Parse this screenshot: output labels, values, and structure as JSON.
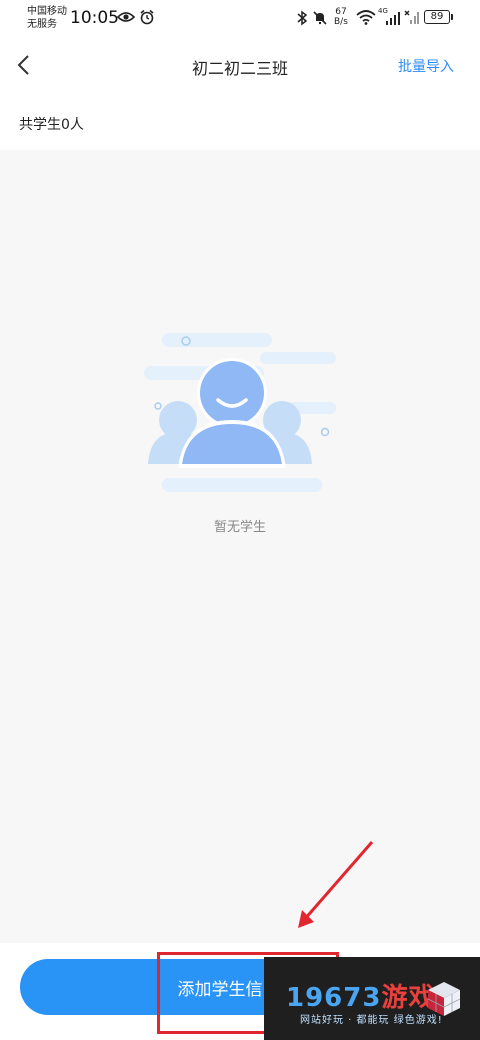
{
  "status_bar": {
    "carrier_line1": "中国移动",
    "carrier_line2": "无服务",
    "time": "10:05",
    "speed_value": "67",
    "speed_unit": "B/s",
    "network": "4G",
    "battery": "89"
  },
  "header": {
    "title": "初二初二三班",
    "import_label": "批量导入"
  },
  "summary": {
    "student_count": "共学生0人"
  },
  "empty_state": {
    "text": "暂无学生"
  },
  "footer": {
    "add_button_label": "添加学生信"
  },
  "watermark": {
    "logo_num": "19673",
    "logo_cn": "游戏",
    "slogan": "网站好玩 · 都能玩 绿色游戏!"
  },
  "colors": {
    "accent": "#2a93f6",
    "annotation": "#e0262f"
  }
}
